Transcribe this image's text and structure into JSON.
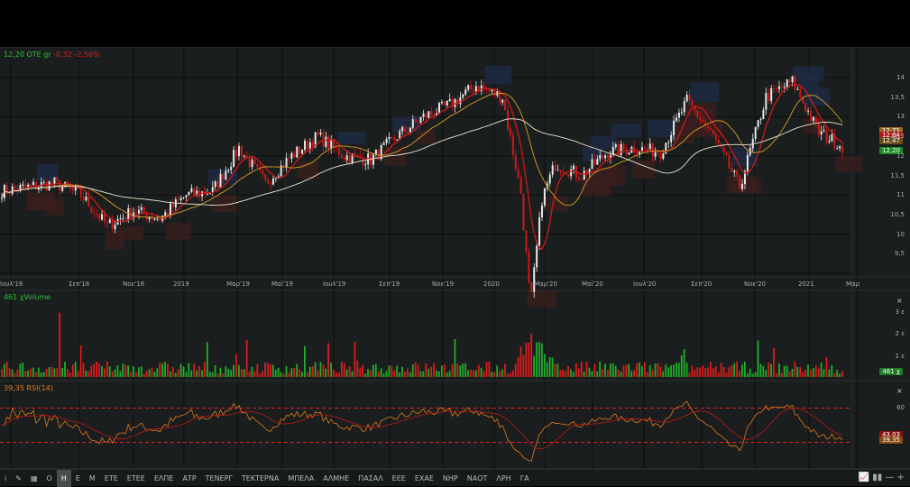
{
  "header": {
    "price": "12,20",
    "symbol": "ΟΤΕ gr",
    "change": "-0,32",
    "change_pct": "-2,56%"
  },
  "volume_panel": {
    "label": "461 χVolume",
    "axis": [
      "3 ε",
      "2 ε",
      "1 ε"
    ],
    "last_badge": "461 χ",
    "close": "×"
  },
  "rsi_panel": {
    "label": "39,35 RSI(14)",
    "axis": [
      "60"
    ],
    "badges": [
      "43,03",
      "39,35"
    ],
    "close": "×",
    "overbought": 70,
    "oversold": 30
  },
  "price_badges": [
    "12,71",
    "12,64",
    "12,47",
    "12,20"
  ],
  "colors": {
    "up": "#e8e8e8",
    "down": "#d01818",
    "vol_up": "#1fae2a",
    "vol_down": "#e01b1b",
    "ma_short": "#d01818",
    "ma_mid": "#d6a020",
    "ma_long": "#e8e8d0",
    "rsi": "#e07a1a"
  },
  "toolbar": {
    "items": [
      "i",
      "✎",
      "▦",
      "Ο",
      "Η",
      "Ε",
      "Μ",
      "ΕΤΕ",
      "ΕΤΕΕ",
      "ΕΛΠΕ",
      "ΑΤΡ",
      "ΤΕΝΕΡΓ",
      "ΤΕΚΤΕΡΝΑ",
      "ΜΠΕΛΑ",
      "ΑΛΜΗΕ",
      "ΠΑΣΑΛ",
      "ΕΕΕ",
      "ΕΧΑΕ",
      "ΝΗΡ",
      "ΝΑΟΤ",
      "ΛΡΗ",
      "ΓΑ"
    ],
    "active": "Η"
  },
  "chart_data": {
    "type": "candlestick",
    "y_ticks": [
      "14",
      "13,5",
      "13",
      "12,5",
      "12",
      "11,5",
      "11",
      "10,5",
      "10",
      "9,5"
    ],
    "ylim": [
      9.3,
      14.4
    ],
    "x_ticks": [
      "Ιουλ'18",
      "Σεπ'18",
      "Νοε'18",
      "2019",
      "Μαρ'19",
      "Μαϊ'19",
      "Ιουλ'19",
      "Σεπ'19",
      "Νοε'19",
      "2020",
      "Μαρ'20",
      "Μαϊ'20",
      "Ιουλ'20",
      "Σεπ'20",
      "Νοε'20",
      "2021",
      "Μαρ"
    ],
    "monthly_close_approx": [
      11.1,
      11.2,
      11.3,
      11.0,
      10.2,
      10.6,
      10.4,
      11.0,
      11.1,
      12.2,
      11.3,
      12.0,
      12.5,
      12.0,
      11.9,
      12.5,
      13.0,
      13.3,
      13.8,
      13.5,
      10.0,
      11.8,
      11.5,
      12.1,
      12.2,
      12.1,
      13.4,
      12.5,
      11.2,
      13.5,
      13.9,
      12.6,
      12.2
    ]
  }
}
